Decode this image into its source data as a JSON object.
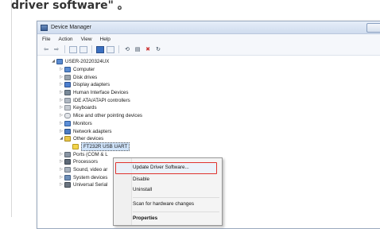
{
  "instruction": "driver software\" 。",
  "window": {
    "title": "Device Manager",
    "menu": [
      "File",
      "Action",
      "View",
      "Help"
    ]
  },
  "tree": {
    "root": "USER-20220324UX",
    "categories": [
      "Computer",
      "Disk drives",
      "Display adapters",
      "Human Interface Devices",
      "IDE ATA/ATAPI controllers",
      "Keyboards",
      "Mice and other pointing devices",
      "Monitors",
      "Network adapters",
      "Other devices"
    ],
    "selected_device": "FT232R USB UART",
    "after": [
      "Ports (COM & L",
      "Processors",
      "Sound, video ar",
      "System devices",
      "Universal Serial"
    ]
  },
  "context_menu": {
    "items": [
      "Update Driver Software...",
      "Disable",
      "Uninstall",
      "Scan for hardware changes",
      "Properties"
    ],
    "highlight_color": "#e0332e"
  }
}
